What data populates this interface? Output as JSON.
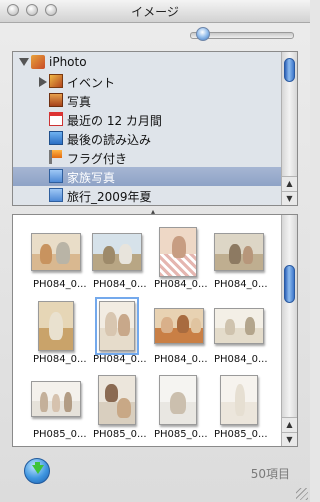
{
  "window": {
    "title": "イメージ"
  },
  "zoom": {
    "level": 0.1
  },
  "sources": [
    {
      "label": "iPhoto",
      "icon": "iphoto-icon",
      "expanded": true,
      "selected": false
    },
    {
      "label": "イベント",
      "icon": "events-icon",
      "expanded": false,
      "selected": false
    },
    {
      "label": "写真",
      "icon": "photos-icon",
      "selected": false
    },
    {
      "label": "最近の 12 カ月間",
      "icon": "calendar-icon",
      "selected": false
    },
    {
      "label": "最後の読み込み",
      "icon": "last-import-icon",
      "selected": false
    },
    {
      "label": "フラグ付き",
      "icon": "flag-icon",
      "selected": false
    },
    {
      "label": "家族写真",
      "icon": "album-icon",
      "selected": true
    },
    {
      "label": "旅行_2009年夏",
      "icon": "album-icon",
      "selected": false
    }
  ],
  "photos": [
    {
      "label": "PH084_0...",
      "selected": false
    },
    {
      "label": "PH084_0...",
      "selected": false
    },
    {
      "label": "PH084_0...",
      "selected": false
    },
    {
      "label": "PH084_0...",
      "selected": false
    },
    {
      "label": "PH084_0...",
      "selected": false
    },
    {
      "label": "PH084_0...",
      "selected": true
    },
    {
      "label": "PH084_0...",
      "selected": false
    },
    {
      "label": "PH084_0...",
      "selected": false
    },
    {
      "label": "PH085_0...",
      "selected": false
    },
    {
      "label": "PH085_0...",
      "selected": false
    },
    {
      "label": "PH085_0...",
      "selected": false
    },
    {
      "label": "PH085_0...",
      "selected": false
    }
  ],
  "status": {
    "count": "50項目"
  },
  "colors": {
    "accent": "#3d76c9",
    "selection": "#8ea3c6"
  }
}
